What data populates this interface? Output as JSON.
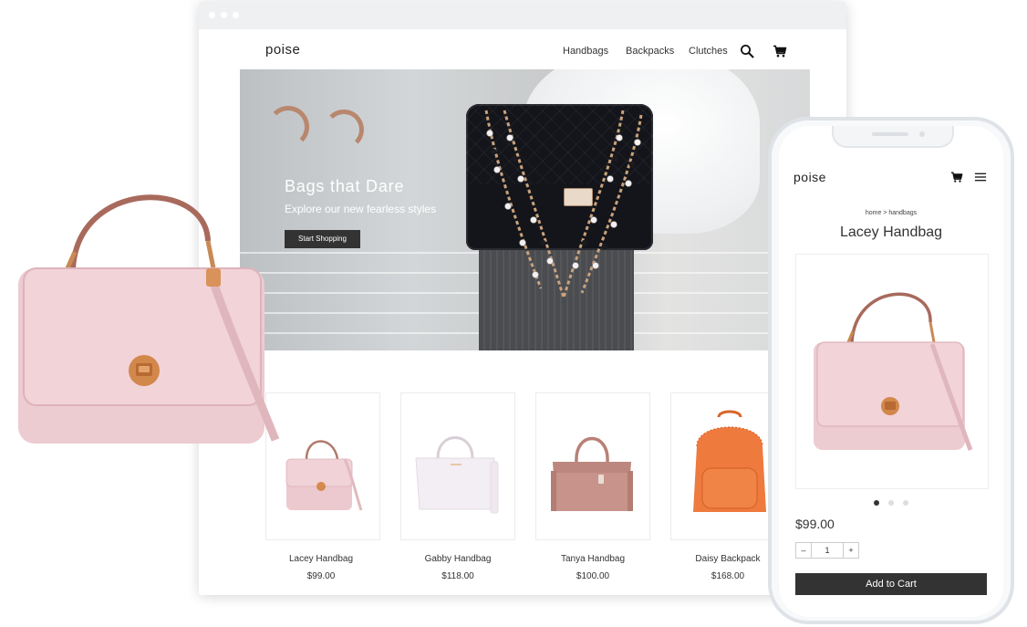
{
  "desktop": {
    "logo": "poise",
    "nav": [
      "Handbags",
      "Backpacks",
      "Clutches"
    ],
    "icons": {
      "search": "search-icon",
      "cart": "cart-icon"
    },
    "hero": {
      "title": "Bags that Dare",
      "subtitle": "Explore our new fearless styles",
      "button": "Start Shopping"
    },
    "products": [
      {
        "name": "Lacey Handbag",
        "price": "$99.00"
      },
      {
        "name": "Gabby Handbag",
        "price": "$118.00"
      },
      {
        "name": "Tanya Handbag",
        "price": "$100.00"
      },
      {
        "name": "Daisy Backpack",
        "price": "$168.00"
      }
    ]
  },
  "mobile": {
    "logo": "poise",
    "icons": {
      "cart": "cart-icon",
      "menu": "hamburger-menu-icon"
    },
    "breadcrumb": "home > handbags",
    "product_title": "Lacey Handbag",
    "price": "$99.00",
    "quantity": {
      "minus": "–",
      "value": "1",
      "plus": "+"
    },
    "add_to_cart": "Add to Cart",
    "carousel": {
      "count": 3,
      "active": 1
    }
  },
  "colors": {
    "dark_button": "#333333",
    "pink_bag": "#ecc9cf",
    "orange_backpack": "#ee7a3e",
    "tan_bag": "#c8938a",
    "white_bag": "#f3eef3"
  }
}
